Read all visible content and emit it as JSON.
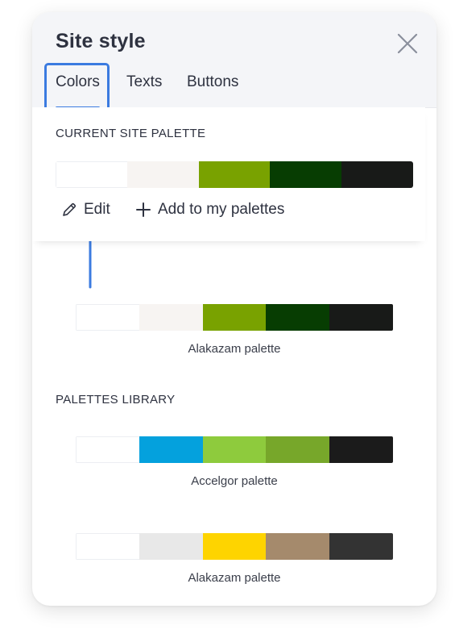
{
  "header": {
    "title": "Site style",
    "tabs": [
      {
        "label": "Colors"
      },
      {
        "label": "Texts"
      },
      {
        "label": "Buttons"
      }
    ]
  },
  "current_palette": {
    "section_title": "CURRENT SITE PALETTE",
    "colors": [
      "#ffffff",
      "#f7f4f2",
      "#79a200",
      "#073d02",
      "#181a18"
    ],
    "actions": {
      "edit_label": "Edit",
      "add_label": "Add to my palettes"
    }
  },
  "suggested_palette": {
    "name": "Alakazam palette",
    "colors": [
      "#ffffff",
      "#f7f4f2",
      "#79a200",
      "#073d02",
      "#181a18"
    ]
  },
  "library": {
    "section_title": "PALETTES LIBRARY",
    "palettes": [
      {
        "name": "Accelgor palette",
        "colors": [
          "#ffffff",
          "#04a1dd",
          "#8ecb3d",
          "#77a72a",
          "#1b1b1b"
        ]
      },
      {
        "name": "Alakazam palette",
        "colors": [
          "#ffffff",
          "#e8e8e8",
          "#fed400",
          "#a58a6c",
          "#333333"
        ]
      }
    ]
  },
  "icons": {
    "close": "close-icon",
    "edit": "pencil-icon",
    "add": "plus-icon",
    "annotation": "arrow-up-icon"
  },
  "accent_color": "#3b7be0"
}
